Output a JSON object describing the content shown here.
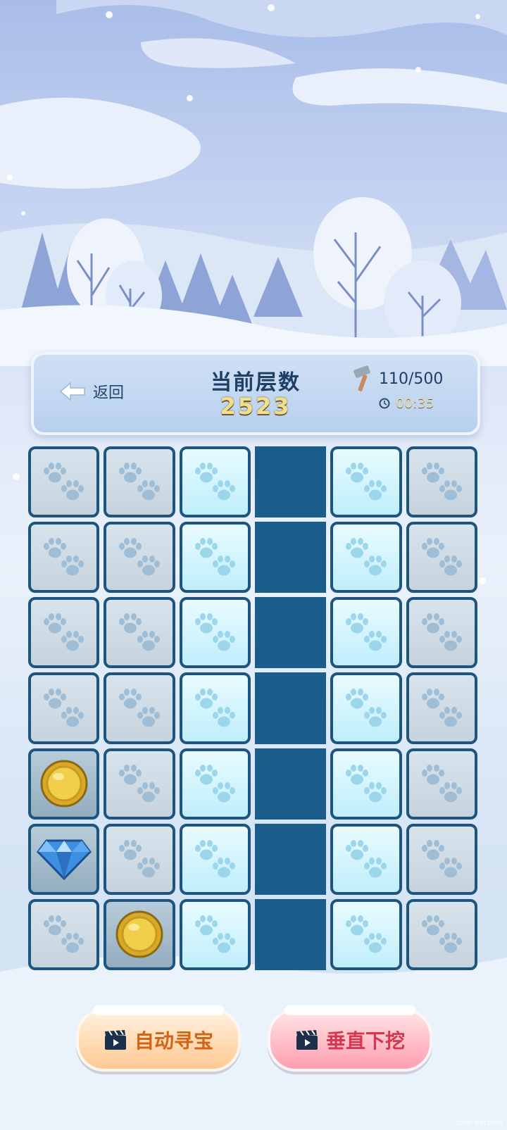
{
  "header": {
    "back_label": "返回",
    "floor_title": "当前层数",
    "floor_value": "2523",
    "hammer_count": "110/500",
    "timer": "00:35",
    "icons": {
      "back": "arrow-left-icon",
      "hammer": "hammer-icon",
      "timer": "clock-icon"
    }
  },
  "grid": {
    "columns": 6,
    "rows": [
      [
        "stone",
        "stone",
        "ice",
        "dug",
        "ice",
        "stone"
      ],
      [
        "stone",
        "stone",
        "ice",
        "dug",
        "ice",
        "stone"
      ],
      [
        "stone",
        "stone",
        "ice",
        "dug",
        "ice",
        "stone"
      ],
      [
        "stone",
        "stone",
        "ice",
        "dug",
        "ice",
        "stone"
      ],
      [
        "coin",
        "stone",
        "ice",
        "dug",
        "ice",
        "stone"
      ],
      [
        "gem",
        "stone",
        "ice",
        "dug",
        "ice",
        "stone"
      ],
      [
        "stone",
        "coin",
        "ice",
        "dug",
        "ice",
        "stone"
      ]
    ]
  },
  "buttons": {
    "auto_label": "自动寻宝",
    "down_label": "垂直下挖",
    "icon": "video-clapper-icon"
  },
  "watermark": "trial version",
  "colors": {
    "dug": "#1a5c8a",
    "border": "#1d557e",
    "auto_text": "#d26416",
    "down_text": "#d4374f"
  }
}
